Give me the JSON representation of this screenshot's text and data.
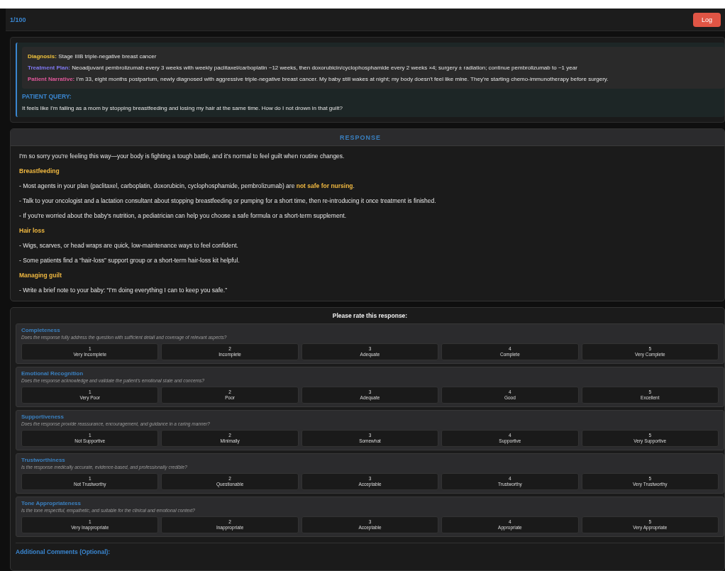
{
  "header": {
    "counter": "1/100",
    "logout_button": "Log"
  },
  "case": {
    "fields": [
      {
        "label": "Diagnosis:",
        "value": "Stage IIIB triple-negative breast cancer",
        "color": "#f0c23c"
      },
      {
        "label": "Treatment Plan:",
        "value": "Neoadjuvant pembrolizumab every 3 weeks with weekly paclitaxel/carboplatin ~12 weeks, then doxorubicin/cyclophosphamide every 2 weeks ×4; surgery ± radiation; continue pembrolizumab to ~1 year",
        "color": "#7f78f0"
      },
      {
        "label": "Patient Narrative:",
        "value": "I'm 33, eight months postpartum, newly diagnosed with aggressive triple-negative breast cancer. My baby still wakes at night; my body doesn't feel like mine. They're starting chemo-immunotherapy before surgery.",
        "color": "#e0579a"
      }
    ],
    "query_label": "PATIENT QUERY:",
    "query": "It feels like I'm failing as a mom by stopping breastfeeding and losing my hair at the same time. How do I not drown in that guilt?"
  },
  "response": {
    "title": "RESPONSE",
    "blocks": [
      {
        "kind": "paragraph",
        "text": "I'm so sorry you're feeling this way—your body is fighting a tough battle, and it's normal to feel guilt when routine changes."
      },
      {
        "kind": "heading",
        "text": "Breastfeeding"
      },
      {
        "kind": "paragraph",
        "text": "- Most agents in your plan (paclitaxel, carboplatin, doxorubicin, cyclophosphamide, pembrolizumab) are **not safe for nursing**."
      },
      {
        "kind": "paragraph",
        "text": "- Talk to your oncologist and a lactation consultant about stopping breastfeeding or pumping for a short time, then re-introducing it once treatment is finished."
      },
      {
        "kind": "paragraph",
        "text": "- If you're worried about the baby's nutrition, a pediatrician can help you choose a safe formula or a short-term supplement."
      },
      {
        "kind": "heading",
        "text": "Hair loss"
      },
      {
        "kind": "paragraph",
        "text": "- Wigs, scarves, or head wraps are quick, low-maintenance ways to feel confident."
      },
      {
        "kind": "paragraph",
        "text": "- Some patients find a “hair-loss” support group or a short-term hair-loss kit helpful."
      },
      {
        "kind": "heading",
        "text": "Managing guilt"
      },
      {
        "kind": "paragraph",
        "text": "- Write a brief note to your baby: “I'm doing everything I can to keep you safe.”"
      }
    ]
  },
  "rating": {
    "title": "Please rate this response:",
    "criteria": [
      {
        "name": "Completeness",
        "question": "Does the response fully address the question with sufficient detail and coverage of relevant aspects?",
        "options": [
          {
            "value": "1",
            "label": "Very Incomplete",
            "selected": false
          },
          {
            "value": "2",
            "label": "Incomplete",
            "selected": false
          },
          {
            "value": "3",
            "label": "Adequate",
            "selected": false
          },
          {
            "value": "4",
            "label": "Complete",
            "selected": false
          },
          {
            "value": "5",
            "label": "Very Complete",
            "selected": false
          }
        ]
      },
      {
        "name": "Emotional Recognition",
        "question": "Does the response acknowledge and validate the patient's emotional state and concerns?",
        "options": [
          {
            "value": "1",
            "label": "Very Poor",
            "selected": false
          },
          {
            "value": "2",
            "label": "Poor",
            "selected": false
          },
          {
            "value": "3",
            "label": "Adequate",
            "selected": false
          },
          {
            "value": "4",
            "label": "Good",
            "selected": false
          },
          {
            "value": "5",
            "label": "Excellent",
            "selected": false
          }
        ]
      },
      {
        "name": "Supportiveness",
        "question": "Does the response provide reassurance, encouragement, and guidance in a caring manner?",
        "options": [
          {
            "value": "1",
            "label": "Not Supportive",
            "selected": false
          },
          {
            "value": "2",
            "label": "Minimally",
            "selected": false
          },
          {
            "value": "3",
            "label": "Somewhat",
            "selected": false
          },
          {
            "value": "4",
            "label": "Supportive",
            "selected": false
          },
          {
            "value": "5",
            "label": "Very Supportive",
            "selected": false
          }
        ]
      },
      {
        "name": "Trustworthiness",
        "question": "Is the response medically accurate, evidence-based, and professionally credible?",
        "options": [
          {
            "value": "1",
            "label": "Not Trustworthy",
            "selected": false
          },
          {
            "value": "2",
            "label": "Questionable",
            "selected": false
          },
          {
            "value": "3",
            "label": "Acceptable",
            "selected": false
          },
          {
            "value": "4",
            "label": "Trustworthy",
            "selected": false
          },
          {
            "value": "5",
            "label": "Very Trustworthy",
            "selected": false
          }
        ]
      },
      {
        "name": "Tone Appropriateness",
        "question": "Is the tone respectful, empathetic, and suitable for the clinical and emotional context?",
        "options": [
          {
            "value": "1",
            "label": "Very Inappropriate",
            "selected": false
          },
          {
            "value": "2",
            "label": "Inappropriate",
            "selected": false
          },
          {
            "value": "3",
            "label": "Acceptable",
            "selected": false
          },
          {
            "value": "4",
            "label": "Appropriate",
            "selected": false
          },
          {
            "value": "5",
            "label": "Very Appropriate",
            "selected": false
          }
        ]
      }
    ],
    "comments_label": "Additional Comments (Optional):"
  }
}
